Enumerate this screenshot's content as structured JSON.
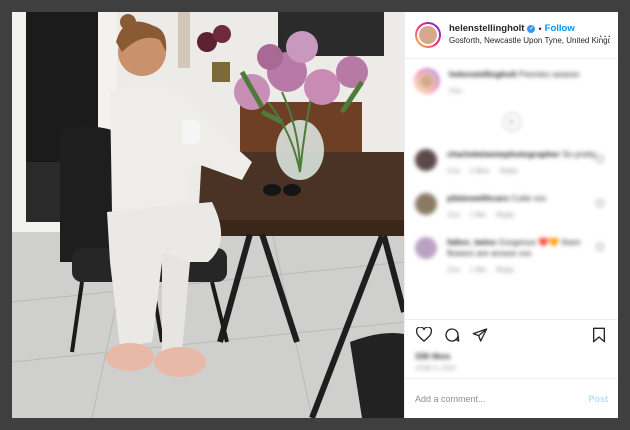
{
  "post": {
    "username": "helenstellingholt",
    "follow_label": "Follow",
    "dot": "•",
    "location": "Gosforth, Newcastle Upon Tyne, United Kingd...",
    "more_label": "...",
    "caption": {
      "username": "helenstellingholt",
      "text": "Peonies season",
      "time": "21w"
    },
    "load_more": "+",
    "comments": [
      {
        "username": "charlottelamiephotographer",
        "text": "So pretty",
        "meta": [
          "21w",
          "2 likes",
          "Reply"
        ],
        "color": "#5b4a4a"
      },
      {
        "username": "pilateswithcaro",
        "text": "Cutie xxx",
        "meta": [
          "21w",
          "1 like",
          "Reply"
        ],
        "color": "#8a7a65"
      },
      {
        "username": "fallon_twins",
        "text": "Gorgeous ❤️🧡 them flowers are amaze xxx",
        "meta": [
          "21w",
          "1 like",
          "Reply"
        ],
        "color": "#b9a2c2"
      }
    ],
    "likes": "336 likes",
    "date": "June 4, 2020",
    "add_comment_placeholder": "Add a comment...",
    "post_label": "Post"
  },
  "icons": [
    "heart-icon",
    "comment-icon",
    "share-icon",
    "bookmark-icon",
    "verified-badge-icon"
  ],
  "colors": {
    "accent": "#0095f6",
    "post_disabled": "#b2dffc",
    "backdrop": "#3f3f3f"
  }
}
